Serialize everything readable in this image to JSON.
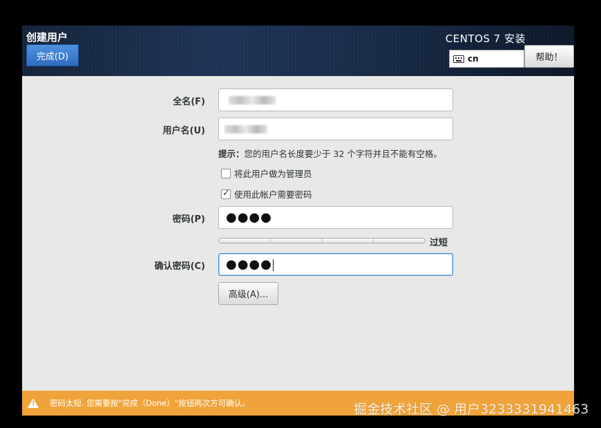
{
  "header": {
    "title": "创建用户",
    "done_label": "完成(D)",
    "installer_title": "CENTOS 7 安装",
    "keyboard_layout": "cn",
    "help_label": "帮助！"
  },
  "form": {
    "fullname_label": "全名(F)",
    "username_label": "用户名(U)",
    "hint_prefix": "提示：",
    "hint_text": "您的用户名长度要少于 32 个字符并且不能有空格。",
    "admin_checkbox_label": "将此用户做为管理员",
    "admin_checked": false,
    "require_password_label": "使用此帐户需要密码",
    "require_password_checked": true,
    "password_label": "密码(P)",
    "password_value": "●●●●",
    "strength_label": "过短",
    "confirm_label": "确认密码(C)",
    "confirm_value": "●●●●",
    "advanced_label": "高级(A)..."
  },
  "warning": {
    "text": "密码太短. 您需要按\"完成（Done）\"按钮两次方可确认。"
  },
  "watermark": "掘金技术社区 @ 用户3233331941463",
  "colors": {
    "done_button": "#3a7bd5",
    "warning_bar": "#f0a33a",
    "focus_border": "#4a90d9"
  }
}
